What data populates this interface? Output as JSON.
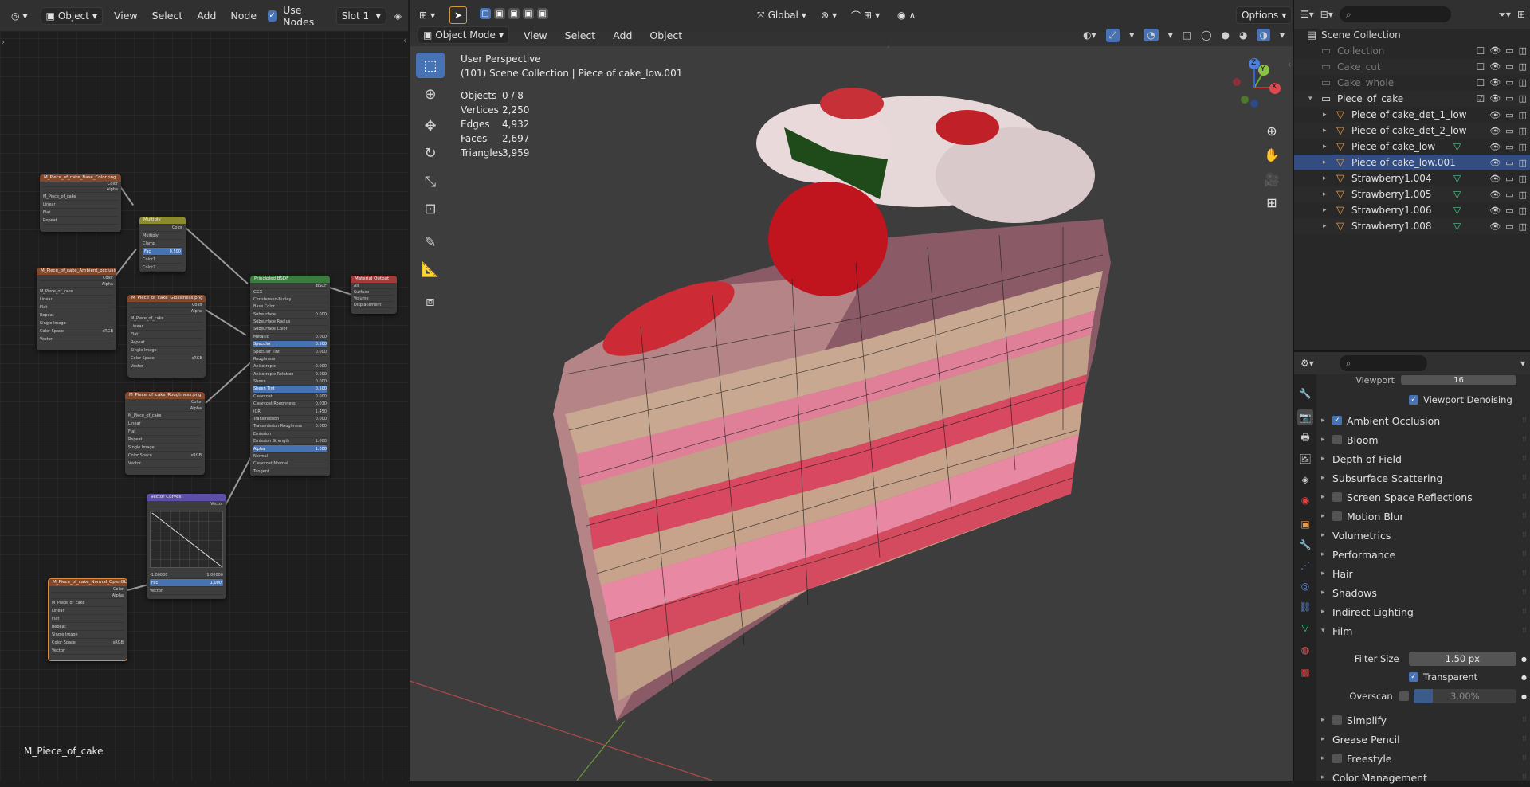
{
  "node_editor": {
    "header": {
      "mode": "Object",
      "menus": [
        "View",
        "Select",
        "Add",
        "Node"
      ],
      "use_nodes_label": "Use Nodes",
      "slot": "Slot 1"
    },
    "material_name": "M_Piece_of_cake",
    "nodes": {
      "base_color": {
        "title": "M_Piece_of_cake_Base_Color.png",
        "image": "M_Piece_of_cake",
        "outputs": [
          "Color",
          "Alpha"
        ],
        "rows": [
          "Linear",
          "Flat",
          "Repeat",
          "Single Image"
        ],
        "color_space_label": "Color Space",
        "color_space": "sRGB",
        "vector": "Vector"
      },
      "multiply": {
        "title": "Multiply",
        "output": "Color",
        "rows": [
          "Multiply",
          "Clamp"
        ],
        "fac_label": "Fac",
        "fac": "0.500",
        "inputs": [
          "Color1",
          "Color2"
        ]
      },
      "ambient": {
        "title": "M_Piece_of_cake_Ambient_occlusion.png",
        "image": "M_Piece_of_cake",
        "outputs": [
          "Color",
          "Alpha"
        ],
        "rows": [
          "Linear",
          "Flat",
          "Repeat",
          "Single Image"
        ],
        "color_space_label": "Color Space",
        "color_space": "sRGB",
        "vector": "Vector"
      },
      "glossiness": {
        "title": "M_Piece_of_cake_Glossiness.png",
        "image": "M_Piece_of_cake",
        "outputs": [
          "Color",
          "Alpha"
        ],
        "rows": [
          "Linear",
          "Flat",
          "Repeat",
          "Single Image"
        ],
        "color_space_label": "Color Space",
        "color_space": "sRGB",
        "vector": "Vector"
      },
      "roughness": {
        "title": "M_Piece_of_cake_Roughness.png",
        "image": "M_Piece_of_cake",
        "outputs": [
          "Color",
          "Alpha"
        ],
        "rows": [
          "Linear",
          "Flat",
          "Repeat",
          "Single Image"
        ],
        "color_space_label": "Color Space",
        "color_space": "sRGB",
        "vector": "Vector"
      },
      "normal": {
        "title": "M_Piece_of_cake_Normal_OpenGL.png",
        "image": "M_Piece_of_cake",
        "outputs": [
          "Color",
          "Alpha"
        ],
        "rows": [
          "Linear",
          "Flat",
          "Repeat",
          "Single Image"
        ],
        "color_space_label": "Color Space",
        "color_space": "sRGB",
        "vector": "Vector"
      },
      "vector_curves": {
        "title": "Vector Curves",
        "output": "Vector",
        "min": "-1.00000",
        "max": "1.00000",
        "fac_label": "Fac",
        "fac": "1.000",
        "input": "Vector"
      },
      "bsdf": {
        "title": "Principled BSDF",
        "output": "BSDF",
        "dist": "GGX",
        "sss": "Christensen-Burley",
        "rows": [
          {
            "l": "Base Color",
            "v": ""
          },
          {
            "l": "Subsurface",
            "v": "0.000"
          },
          {
            "l": "Subsurface Radius",
            "v": ""
          },
          {
            "l": "Subsurface Color",
            "v": ""
          },
          {
            "l": "Metallic",
            "v": "0.000"
          },
          {
            "l": "Specular",
            "v": "0.500"
          },
          {
            "l": "Specular Tint",
            "v": "0.000"
          },
          {
            "l": "Roughness",
            "v": ""
          },
          {
            "l": "Anisotropic",
            "v": "0.000"
          },
          {
            "l": "Anisotropic Rotation",
            "v": "0.000"
          },
          {
            "l": "Sheen",
            "v": "0.000"
          },
          {
            "l": "Sheen Tint",
            "v": "0.500"
          },
          {
            "l": "Clearcoat",
            "v": "0.000"
          },
          {
            "l": "Clearcoat Roughness",
            "v": "0.030"
          },
          {
            "l": "IOR",
            "v": "1.450"
          },
          {
            "l": "Transmission",
            "v": "0.000"
          },
          {
            "l": "Transmission Roughness",
            "v": "0.000"
          },
          {
            "l": "Emission",
            "v": ""
          },
          {
            "l": "Emission Strength",
            "v": "1.000"
          },
          {
            "l": "Alpha",
            "v": "1.000"
          },
          {
            "l": "Normal",
            "v": ""
          },
          {
            "l": "Clearcoat Normal",
            "v": ""
          },
          {
            "l": "Tangent",
            "v": ""
          }
        ]
      },
      "output": {
        "title": "Material Output",
        "target": "All",
        "inputs": [
          "Surface",
          "Volume",
          "Displacement"
        ]
      }
    }
  },
  "viewport": {
    "header": {
      "orientation": "Global",
      "options": "Options"
    },
    "mode": "Object Mode",
    "menus": [
      "View",
      "Select",
      "Add",
      "Object"
    ],
    "overlay": {
      "title": "User Perspective",
      "subtitle": "(101) Scene Collection | Piece of cake_low.001"
    },
    "stats": [
      {
        "label": "Objects",
        "value": "0 / 8"
      },
      {
        "label": "Vertices",
        "value": "2,250"
      },
      {
        "label": "Edges",
        "value": "4,932"
      },
      {
        "label": "Faces",
        "value": "2,697"
      },
      {
        "label": "Triangles",
        "value": "3,959"
      }
    ],
    "gizmo": {
      "x": "X",
      "y": "Y",
      "z": "Z"
    }
  },
  "outliner": {
    "root": "Scene Collection",
    "items": [
      {
        "name": "Collection",
        "indent": 1,
        "type": "collection",
        "dim": true,
        "checked": false
      },
      {
        "name": "Cake_cut",
        "indent": 1,
        "type": "collection",
        "dim": true,
        "checked": false
      },
      {
        "name": "Cake_whole",
        "indent": 1,
        "type": "collection",
        "dim": true,
        "checked": false
      },
      {
        "name": "Piece_of_cake",
        "indent": 1,
        "type": "collection",
        "dim": false,
        "checked": true,
        "expanded": true
      },
      {
        "name": "Piece of cake_det_1_low",
        "indent": 2,
        "type": "mesh",
        "dim": false
      },
      {
        "name": "Piece of cake_det_2_low",
        "indent": 2,
        "type": "mesh",
        "dim": false
      },
      {
        "name": "Piece of cake_low",
        "indent": 2,
        "type": "mesh",
        "dim": false
      },
      {
        "name": "Piece of cake_low.001",
        "indent": 2,
        "type": "mesh",
        "dim": false,
        "selected": true
      },
      {
        "name": "Strawberry1.004",
        "indent": 2,
        "type": "mesh",
        "dim": false
      },
      {
        "name": "Strawberry1.005",
        "indent": 2,
        "type": "mesh",
        "dim": false
      },
      {
        "name": "Strawberry1.006",
        "indent": 2,
        "type": "mesh",
        "dim": false
      },
      {
        "name": "Strawberry1.008",
        "indent": 2,
        "type": "mesh",
        "dim": false
      }
    ]
  },
  "properties": {
    "viewport_label": "Viewport",
    "viewport_value": "16",
    "viewport_denoising": "Viewport Denoising",
    "panels": [
      {
        "label": "Ambient Occlusion",
        "checkbox": true,
        "checked": true
      },
      {
        "label": "Bloom",
        "checkbox": true,
        "checked": false
      },
      {
        "label": "Depth of Field",
        "checkbox": false
      },
      {
        "label": "Subsurface Scattering",
        "checkbox": false
      },
      {
        "label": "Screen Space Reflections",
        "checkbox": true,
        "checked": false
      },
      {
        "label": "Motion Blur",
        "checkbox": true,
        "checked": false
      },
      {
        "label": "Volumetrics",
        "checkbox": false
      },
      {
        "label": "Performance",
        "checkbox": false
      },
      {
        "label": "Hair",
        "checkbox": false
      },
      {
        "label": "Shadows",
        "checkbox": false
      },
      {
        "label": "Indirect Lighting",
        "checkbox": false
      },
      {
        "label": "Film",
        "checkbox": false,
        "expanded": true
      }
    ],
    "film": {
      "filter_size_label": "Filter Size",
      "filter_size": "1.50 px",
      "transparent_label": "Transparent",
      "overscan_label": "Overscan",
      "overscan": "3.00%"
    },
    "panels_after": [
      {
        "label": "Simplify",
        "checkbox": true,
        "checked": false
      },
      {
        "label": "Grease Pencil",
        "checkbox": false
      },
      {
        "label": "Freestyle",
        "checkbox": true,
        "checked": false
      },
      {
        "label": "Color Management",
        "checkbox": false
      }
    ]
  }
}
